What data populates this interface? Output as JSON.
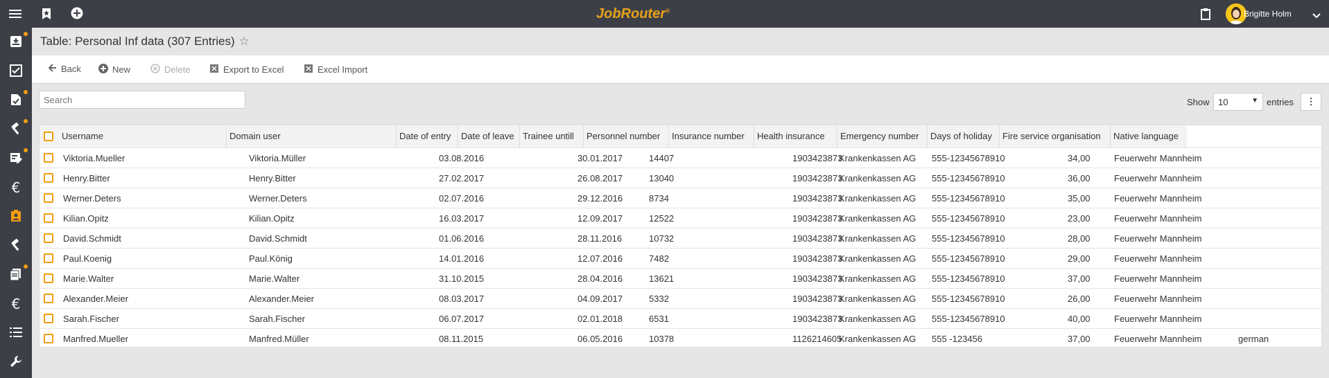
{
  "header": {
    "brand": "JobRouter",
    "brand_mark": "®",
    "user_name": "Brigitte Holm"
  },
  "page": {
    "title": "Table: Personal Inf data (307 Entries)"
  },
  "toolbar": {
    "back": "Back",
    "new": "New",
    "delete": "Delete",
    "export": "Export to Excel",
    "import": "Excel Import"
  },
  "search": {
    "placeholder": "Search"
  },
  "paging": {
    "show": "Show",
    "value": "10",
    "entries": "entries"
  },
  "table": {
    "headers": [
      "Username",
      "Domain user",
      "Date of entry",
      "Date of leave",
      "Trainee untill",
      "Personnel number",
      "Insurance number",
      "Health insurance",
      "Emergency number",
      "Days of holiday",
      "Fire service organisation",
      "Native language"
    ],
    "rows": [
      [
        "Viktoria.Mueller",
        "Viktoria.Müller",
        "03.08.2016",
        "30.01.2017",
        "14407",
        "1903423873",
        "Krankenkassen AG",
        "555-12345678910",
        "34,00",
        "Feuerwehr Mannheim",
        ""
      ],
      [
        "Henry.Bitter",
        "Henry.Bitter",
        "27.02.2017",
        "26.08.2017",
        "13040",
        "1903423873",
        "Krankenkassen AG",
        "555-12345678910",
        "36,00",
        "Feuerwehr Mannheim",
        ""
      ],
      [
        "Werner.Deters",
        "Werner.Deters",
        "02.07.2016",
        "29.12.2016",
        "8734",
        "1903423873",
        "Krankenkassen AG",
        "555-12345678910",
        "35,00",
        "Feuerwehr Mannheim",
        ""
      ],
      [
        "Kilian.Opitz",
        "Kilian.Opitz",
        "16.03.2017",
        "12.09.2017",
        "12522",
        "1903423873",
        "Krankenkassen AG",
        "555-12345678910",
        "23,00",
        "Feuerwehr Mannheim",
        ""
      ],
      [
        "David.Schmidt",
        "David.Schmidt",
        "01.06.2016",
        "28.11.2016",
        "10732",
        "1903423873",
        "Krankenkassen AG",
        "555-12345678910",
        "28,00",
        "Feuerwehr Mannheim",
        ""
      ],
      [
        "Paul.Koenig",
        "Paul.König",
        "14.01.2016",
        "12.07.2016",
        "7482",
        "1903423873",
        "Krankenkassen AG",
        "555-12345678910",
        "29,00",
        "Feuerwehr Mannheim",
        ""
      ],
      [
        "Marie.Walter",
        "Marie.Walter",
        "31.10.2015",
        "28.04.2016",
        "13621",
        "1903423873",
        "Krankenkassen AG",
        "555-12345678910",
        "37,00",
        "Feuerwehr Mannheim",
        ""
      ],
      [
        "Alexander.Meier",
        "Alexander.Meier",
        "08.03.2017",
        "04.09.2017",
        "5332",
        "1903423873",
        "Krankenkassen AG",
        "555-12345678910",
        "26,00",
        "Feuerwehr Mannheim",
        ""
      ],
      [
        "Sarah.Fischer",
        "Sarah.Fischer",
        "06.07.2017",
        "02.01.2018",
        "6531",
        "1903423873",
        "Krankenkassen AG",
        "555-12345678910",
        "40,00",
        "Feuerwehr Mannheim",
        ""
      ],
      [
        "Manfred.Mueller",
        "Manfred.Müller",
        "08.11.2015",
        "06.05.2016",
        "10378",
        "1126214605",
        "Krankenkassen AG",
        "555 -123456",
        "37,00",
        "Feuerwehr Mannheim",
        "german"
      ]
    ]
  },
  "colors": {
    "accent": "#f39c12",
    "topbar": "#3d3f47",
    "brand": "#e8a317"
  }
}
